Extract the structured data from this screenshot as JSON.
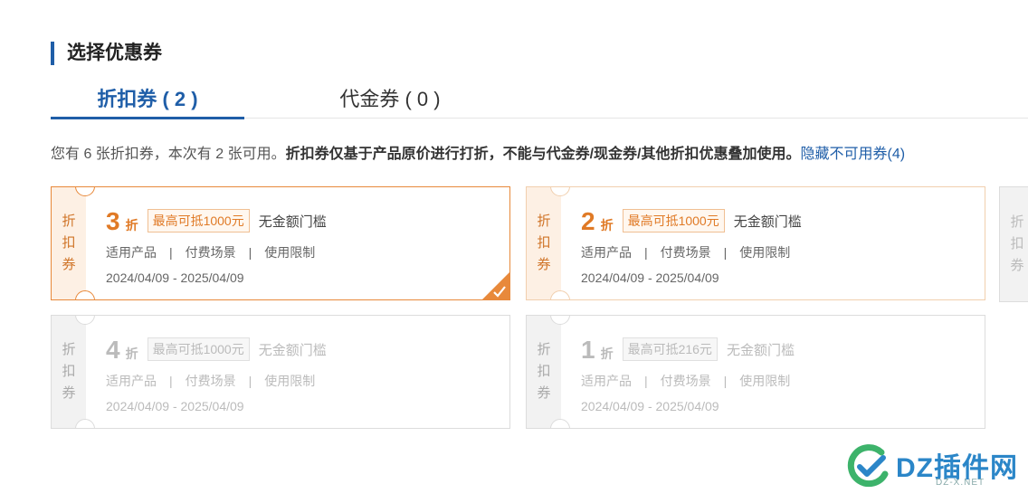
{
  "section_title": "选择优惠券",
  "tabs": [
    {
      "label": "折扣券 ( 2 )",
      "active": true
    },
    {
      "label": "代金券 ( 0 )",
      "active": false
    }
  ],
  "notice": {
    "normal": "您有 6 张折扣券，本次有 2 张可用。",
    "bold": "折扣券仅基于产品原价进行打折，不能与代金券/现金券/其他折扣优惠叠加使用。",
    "link": "隐藏不可用券(4)"
  },
  "coupons": [
    {
      "stub": [
        "折",
        "扣",
        "券"
      ],
      "amount": "3",
      "unit": "折",
      "cap": "最高可抵1000元",
      "threshold": "无金额门槛",
      "links": [
        "适用产品",
        "付费场景",
        "使用限制"
      ],
      "separator": "|",
      "date_range": "2024/04/09 - 2025/04/09",
      "state": "selected"
    },
    {
      "stub": [
        "折",
        "扣",
        "券"
      ],
      "amount": "2",
      "unit": "折",
      "cap": "最高可抵1000元",
      "threshold": "无金额门槛",
      "links": [
        "适用产品",
        "付费场景",
        "使用限制"
      ],
      "separator": "|",
      "date_range": "2024/04/09 - 2025/04/09",
      "state": "available"
    },
    {
      "stub": [
        "折",
        "扣",
        "券"
      ],
      "amount": "4",
      "unit": "折",
      "cap": "最高可抵1000元",
      "threshold": "无金额门槛",
      "links": [
        "适用产品",
        "付费场景",
        "使用限制"
      ],
      "separator": "|",
      "date_range": "2024/04/09 - 2025/04/09",
      "state": "disabled"
    },
    {
      "stub": [
        "折",
        "扣",
        "券"
      ],
      "amount": "1",
      "unit": "折",
      "cap": "最高可抵216元",
      "threshold": "无金额门槛",
      "links": [
        "适用产品",
        "付费场景",
        "使用限制"
      ],
      "separator": "|",
      "date_range": "2024/04/09 - 2025/04/09",
      "state": "disabled"
    }
  ],
  "partial_coupon": {
    "stub": [
      "折",
      "扣",
      "券"
    ]
  },
  "watermark": {
    "text": "DZ插件网",
    "sub": "DZ-X.NET"
  },
  "colors": {
    "accent": "#1f5ea8",
    "coupon_orange": "#e07a26",
    "disabled_gray": "#bbbbbb"
  }
}
